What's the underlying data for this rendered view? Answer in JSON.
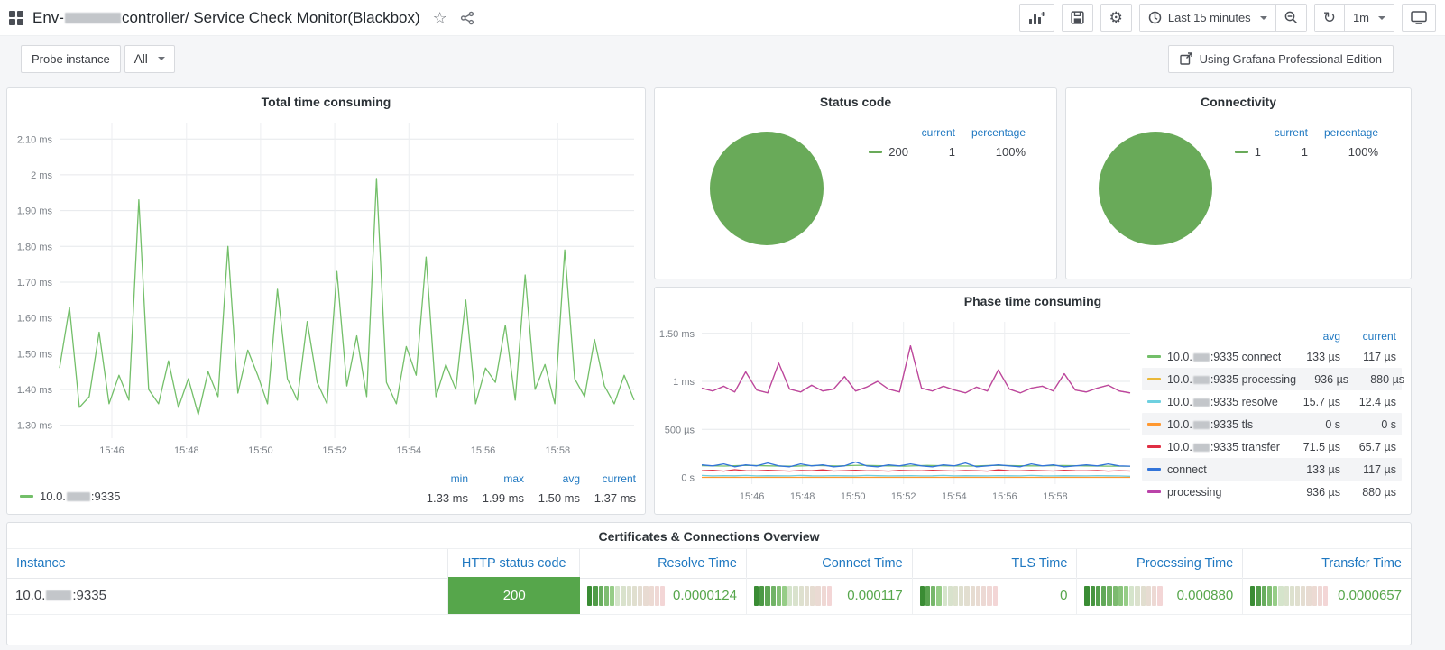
{
  "colors": {
    "accent_blue": "#1f78c1",
    "series_green": "#73bf69",
    "pie_green": "#69aa59",
    "status_green": "#56a64b",
    "value_green": "#56a64b"
  },
  "nav": {
    "title_prefix": "Env-",
    "title_mid": "controller",
    "title_suffix": " / Service Check Monitor(Blackbox)",
    "time_range": "Last 15 minutes",
    "refresh": "1m"
  },
  "variables": {
    "label": "Probe instance",
    "value": "All"
  },
  "edition": {
    "label": "Using Grafana Professional Edition"
  },
  "panels": {
    "total": {
      "title": "Total time consuming",
      "series_prefix": "10.0.",
      "series_suffix": ":9335",
      "stats": {
        "min_h": "min",
        "max_h": "max",
        "avg_h": "avg",
        "cur_h": "current",
        "min": "1.33 ms",
        "max": "1.99 ms",
        "avg": "1.50 ms",
        "cur": "1.37 ms"
      }
    },
    "status": {
      "title": "Status code",
      "cur_h": "current",
      "pct_h": "percentage",
      "label": "200",
      "cur": "1",
      "pct": "100%"
    },
    "conn": {
      "title": "Connectivity",
      "cur_h": "current",
      "pct_h": "percentage",
      "label": "1",
      "cur": "1",
      "pct": "100%"
    },
    "phase": {
      "title": "Phase time consuming",
      "avg_h": "avg",
      "cur_h": "current",
      "rows": [
        {
          "prefix": "10.0.",
          "suffix": ":9335 connect",
          "avg": "133 µs",
          "cur": "117 µs"
        },
        {
          "prefix": "10.0.",
          "suffix": ":9335 processing",
          "avg": "936 µs",
          "cur": "880 µs"
        },
        {
          "prefix": "10.0.",
          "suffix": ":9335 resolve",
          "avg": "15.7 µs",
          "cur": "12.4 µs"
        },
        {
          "prefix": "10.0.",
          "suffix": ":9335 tls",
          "avg": "0 s",
          "cur": "0 s"
        },
        {
          "prefix": "10.0.",
          "suffix": ":9335 transfer",
          "avg": "71.5 µs",
          "cur": "65.7 µs"
        },
        {
          "prefix": "",
          "suffix": "connect",
          "avg": "133 µs",
          "cur": "117 µs"
        },
        {
          "prefix": "",
          "suffix": "processing",
          "avg": "936 µs",
          "cur": "880 µs"
        }
      ]
    },
    "table": {
      "title": "Certificates & Connections Overview",
      "columns": [
        "Instance",
        "HTTP status code",
        "Resolve Time",
        "Connect Time",
        "TLS Time",
        "Processing Time",
        "Transfer Time"
      ],
      "row": {
        "instance_prefix": "10.0.",
        "instance_suffix": ":9335",
        "status": "200",
        "resolve": {
          "value": "0.0000124",
          "frac": 0.36
        },
        "connect": {
          "value": "0.000117",
          "frac": 0.43
        },
        "tls": {
          "value": "0",
          "frac": 0.29
        },
        "processing": {
          "value": "0.000880",
          "frac": 0.57
        },
        "transfer": {
          "value": "0.0000657",
          "frac": 0.36
        }
      }
    }
  },
  "chart_data": [
    {
      "id": "total",
      "type": "line",
      "title": "Total time consuming",
      "xlabel": "time",
      "ylabel": "ms",
      "ylim": [
        1.264,
        2.146
      ],
      "yticks": [
        {
          "label": "2.10 ms",
          "v": 2.1
        },
        {
          "label": "2 ms",
          "v": 2.0
        },
        {
          "label": "1.90 ms",
          "v": 1.9
        },
        {
          "label": "1.80 ms",
          "v": 1.8
        },
        {
          "label": "1.70 ms",
          "v": 1.7
        },
        {
          "label": "1.60 ms",
          "v": 1.6
        },
        {
          "label": "1.50 ms",
          "v": 1.5
        },
        {
          "label": "1.40 ms",
          "v": 1.4
        },
        {
          "label": "1.30 ms",
          "v": 1.3
        }
      ],
      "xticks": [
        "15:46",
        "15:48",
        "15:50",
        "15:52",
        "15:54",
        "15:56",
        "15:58"
      ],
      "xtick_pos": [
        0.091,
        0.221,
        0.35,
        0.479,
        0.608,
        0.737,
        0.867
      ],
      "series": [
        {
          "name": "10.0.[redacted]:9335",
          "color": "#73bf69",
          "values": [
            1.46,
            1.63,
            1.35,
            1.38,
            1.56,
            1.36,
            1.44,
            1.37,
            1.93,
            1.4,
            1.36,
            1.48,
            1.35,
            1.43,
            1.33,
            1.45,
            1.38,
            1.8,
            1.39,
            1.51,
            1.44,
            1.36,
            1.68,
            1.43,
            1.37,
            1.59,
            1.42,
            1.36,
            1.73,
            1.41,
            1.55,
            1.38,
            1.99,
            1.42,
            1.36,
            1.52,
            1.44,
            1.77,
            1.38,
            1.47,
            1.4,
            1.65,
            1.36,
            1.46,
            1.42,
            1.58,
            1.37,
            1.72,
            1.4,
            1.47,
            1.36,
            1.79,
            1.43,
            1.38,
            1.54,
            1.41,
            1.36,
            1.44,
            1.37
          ]
        }
      ],
      "stats": {
        "min": "1.33 ms",
        "max": "1.99 ms",
        "avg": "1.50 ms",
        "current": "1.37 ms"
      }
    },
    {
      "id": "phase",
      "type": "line",
      "title": "Phase time consuming",
      "xlabel": "time",
      "ylabel": "ms",
      "ylim": [
        -0.07,
        1.62
      ],
      "yticks": [
        {
          "label": "1.50 ms",
          "v": 1.5
        },
        {
          "label": "1 ms",
          "v": 1.0
        },
        {
          "label": "500 µs",
          "v": 0.5
        },
        {
          "label": "0 s",
          "v": 0
        }
      ],
      "xticks": [
        "15:46",
        "15:48",
        "15:50",
        "15:52",
        "15:54",
        "15:56",
        "15:58"
      ],
      "xtick_pos": [
        0.117,
        0.235,
        0.353,
        0.471,
        0.589,
        0.707,
        0.825
      ],
      "series": [
        {
          "name": "10.0.[redacted]:9335 connect",
          "color": "#73bf69",
          "values": [
            0.122,
            0.118,
            0.125,
            0.12,
            0.116,
            0.123,
            0.119,
            0.126,
            0.121,
            0.117,
            0.124,
            0.12,
            0.118,
            0.125,
            0.121,
            0.119,
            0.123,
            0.12,
            0.117,
            0.117
          ]
        },
        {
          "name": "10.0.[redacted]:9335 processing",
          "color": "#eab839",
          "values": [
            0.93,
            0.9,
            0.95,
            0.89,
            1.1,
            0.91,
            0.88,
            1.19,
            0.92,
            0.89,
            0.96,
            0.9,
            0.92,
            1.05,
            0.9,
            0.94,
            1.0,
            0.92,
            0.89,
            1.37,
            0.93,
            0.9,
            0.95,
            0.91,
            0.88,
            0.94,
            0.9,
            1.12,
            0.92,
            0.88,
            0.93,
            0.95,
            0.9,
            1.08,
            0.91,
            0.89,
            0.93,
            0.96,
            0.9,
            0.88
          ]
        },
        {
          "name": "10.0.[redacted]:9335 resolve",
          "color": "#6ed0e0",
          "values": [
            0.02,
            0.015,
            0.018,
            0.016,
            0.02,
            0.015,
            0.017,
            0.016,
            0.015,
            0.02,
            0.016,
            0.015,
            0.018,
            0.016,
            0.015,
            0.02,
            0.017,
            0.015,
            0.016,
            0.018,
            0.015,
            0.016,
            0.02,
            0.015,
            0.017,
            0.016,
            0.015,
            0.018,
            0.016,
            0.015,
            0.02,
            0.016,
            0.015,
            0.017,
            0.016,
            0.015,
            0.018,
            0.016,
            0.015,
            0.012
          ]
        },
        {
          "name": "10.0.[redacted]:9335 tls",
          "color": "#ff9830",
          "values": [
            0,
            0
          ]
        },
        {
          "name": "10.0.[redacted]:9335 transfer",
          "color": "#e02f44",
          "values": [
            0.07,
            0.075,
            0.065,
            0.08,
            0.07,
            0.068,
            0.075,
            0.07,
            0.065,
            0.072,
            0.07,
            0.078,
            0.066,
            0.07,
            0.075,
            0.068,
            0.07,
            0.065,
            0.073,
            0.07,
            0.068,
            0.075,
            0.07,
            0.066,
            0.072,
            0.07,
            0.065,
            0.078,
            0.07,
            0.068,
            0.073,
            0.07,
            0.066,
            0.075,
            0.07,
            0.068,
            0.072,
            0.065,
            0.07,
            0.066
          ]
        },
        {
          "name": "connect",
          "color": "#3274d9",
          "values": [
            0.13,
            0.12,
            0.14,
            0.11,
            0.13,
            0.12,
            0.15,
            0.12,
            0.11,
            0.14,
            0.12,
            0.13,
            0.11,
            0.12,
            0.16,
            0.12,
            0.11,
            0.13,
            0.12,
            0.14,
            0.12,
            0.11,
            0.13,
            0.12,
            0.15,
            0.11,
            0.12,
            0.13,
            0.12,
            0.11,
            0.14,
            0.12,
            0.13,
            0.11,
            0.12,
            0.13,
            0.12,
            0.14,
            0.12,
            0.117
          ]
        },
        {
          "name": "processing",
          "color": "#ba43a9",
          "values": [
            0.93,
            0.9,
            0.95,
            0.89,
            1.1,
            0.91,
            0.88,
            1.19,
            0.92,
            0.89,
            0.96,
            0.9,
            0.92,
            1.05,
            0.9,
            0.94,
            1.0,
            0.92,
            0.89,
            1.37,
            0.93,
            0.9,
            0.95,
            0.91,
            0.88,
            0.94,
            0.9,
            1.12,
            0.92,
            0.88,
            0.93,
            0.95,
            0.9,
            1.08,
            0.91,
            0.89,
            0.93,
            0.96,
            0.9,
            0.88
          ]
        }
      ]
    },
    {
      "id": "status",
      "type": "pie",
      "title": "Status code",
      "legend_headers": [
        "current",
        "percentage"
      ],
      "slices": [
        {
          "label": "200",
          "current": 1,
          "percentage": "100%",
          "color": "#69aa59"
        }
      ]
    },
    {
      "id": "conn",
      "type": "pie",
      "title": "Connectivity",
      "legend_headers": [
        "current",
        "percentage"
      ],
      "slices": [
        {
          "label": "1",
          "current": 1,
          "percentage": "100%",
          "color": "#69aa59"
        }
      ]
    }
  ]
}
